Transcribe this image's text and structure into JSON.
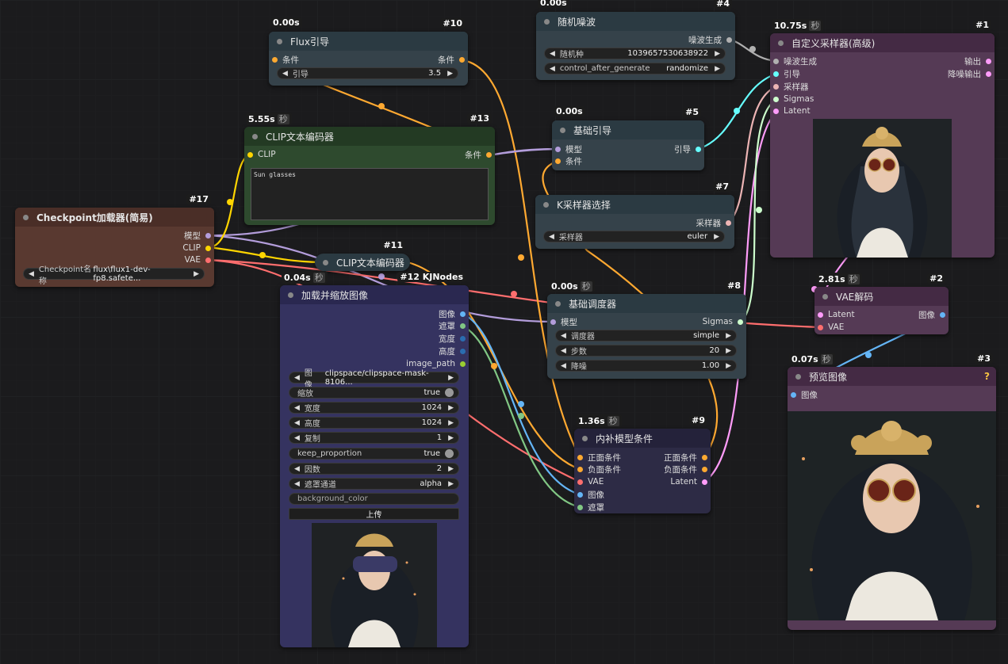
{
  "nodes": {
    "flux_guidance": {
      "id": "#10",
      "time": "0.00s",
      "title": "Flux引导",
      "in": "条件",
      "out": "条件",
      "widget_label": "引导",
      "widget_value": "3.5"
    },
    "random_noise": {
      "id": "#4",
      "time": "0.00s",
      "title": "随机噪波",
      "out": "噪波生成",
      "seed_label": "随机种",
      "seed_value": "1039657530638922",
      "cag_label": "control_after_generate",
      "cag_value": "randomize"
    },
    "custom_sampler": {
      "id": "#1",
      "time": "10.75s",
      "sec": "秒",
      "title": "自定义采样器(高级)",
      "in": [
        "噪波生成",
        "引导",
        "采样器",
        "Sigmas",
        "Latent"
      ],
      "out": [
        "输出",
        "降噪输出"
      ]
    },
    "clip_encode_13": {
      "id": "#13",
      "time": "5.55s",
      "sec": "秒",
      "title": "CLIP文本编码器",
      "in": "CLIP",
      "out": "条件",
      "text": "Sun glasses"
    },
    "basic_guider": {
      "id": "#5",
      "time": "0.00s",
      "title": "基础引导",
      "in": [
        "模型",
        "条件"
      ],
      "out": "引导"
    },
    "ksampler_select": {
      "id": "#7",
      "title": "K采样器选择",
      "out": "采样器",
      "widget_label": "采样器",
      "widget_value": "euler"
    },
    "checkpoint": {
      "id": "#17",
      "title": "Checkpoint加载器(简易)",
      "out": [
        "模型",
        "CLIP",
        "VAE"
      ],
      "widget_label": "Checkpoint名称",
      "widget_value": "flux\\flux1-dev-fp8.safete..."
    },
    "clip_encode_11": {
      "id": "#11",
      "title": "CLIP文本编码器"
    },
    "load_resize": {
      "id": "#12 KJNodes",
      "time": "0.04s",
      "sec": "秒",
      "title": "加载并缩放图像",
      "out": [
        "图像",
        "遮罩",
        "宽度",
        "高度",
        "image_path"
      ],
      "widgets": [
        {
          "label": "图像",
          "value": "clipspace/clipspace-mask-8106...",
          "type": "combo"
        },
        {
          "label": "缩放",
          "value": "true",
          "type": "toggle"
        },
        {
          "label": "宽度",
          "value": "1024",
          "type": "number"
        },
        {
          "label": "高度",
          "value": "1024",
          "type": "number"
        },
        {
          "label": "复制",
          "value": "1",
          "type": "number"
        },
        {
          "label": "keep_proportion",
          "value": "true",
          "type": "toggle"
        },
        {
          "label": "因数",
          "value": "2",
          "type": "number"
        },
        {
          "label": "遮罩通道",
          "value": "alpha",
          "type": "combo"
        },
        {
          "label": "background_color",
          "value": "",
          "type": "text"
        }
      ],
      "upload_label": "上传"
    },
    "basic_scheduler": {
      "id": "#8",
      "time": "0.00s",
      "sec": "秒",
      "title": "基础调度器",
      "in": "模型",
      "out": "Sigmas",
      "widgets": [
        {
          "label": "调度器",
          "value": "simple"
        },
        {
          "label": "步数",
          "value": "20"
        },
        {
          "label": "降噪",
          "value": "1.00"
        }
      ]
    },
    "vae_decode": {
      "id": "#2",
      "time": "2.81s",
      "sec": "秒",
      "title": "VAE解码",
      "in": [
        "Latent",
        "VAE"
      ],
      "out": "图像"
    },
    "preview": {
      "id": "#3",
      "time": "0.07s",
      "sec": "秒",
      "title": "预览图像",
      "in": "图像",
      "q": "?"
    },
    "inpaint_cond": {
      "id": "#9",
      "time": "1.36s",
      "sec": "秒",
      "title": "内补模型条件",
      "in": [
        "正面条件",
        "负面条件",
        "VAE",
        "图像",
        "遮罩"
      ],
      "out": [
        "正面条件",
        "负面条件",
        "Latent"
      ]
    }
  },
  "colors": {
    "model": "#b39ddb",
    "clip": "#ffd500",
    "vae": "#ff6e6e",
    "cond": "#ffa931",
    "image": "#64b5f6",
    "mask": "#81c784",
    "latent": "#ff9cf9",
    "sigmas": "#cdffcd",
    "guider": "#66ffff",
    "noise": "#b0b0b0",
    "sampler": "#ecb4b4"
  }
}
